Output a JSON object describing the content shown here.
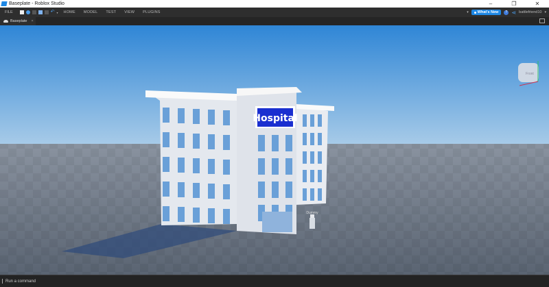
{
  "window": {
    "title": "Baseplate - Roblox Studio",
    "controls": [
      "–",
      "❐",
      "✕"
    ]
  },
  "toolbar": {
    "file": "FILE",
    "tabs": [
      "HOME",
      "MODEL",
      "TEST",
      "VIEW",
      "PLUGINS"
    ],
    "whats_new": "What's New",
    "help": "?",
    "username": "battlefriend10"
  },
  "doc_tab": {
    "label": "Baseplate",
    "close": "×"
  },
  "viewport": {
    "sign_text": "Hospital",
    "npc_label": "Dummy",
    "viewcube_face": "Front"
  },
  "command_bar": {
    "placeholder": "Run a command"
  },
  "colors": {
    "accent": "#1e88e5",
    "sky_top": "#2f86d6",
    "ground": "#5c6675"
  }
}
